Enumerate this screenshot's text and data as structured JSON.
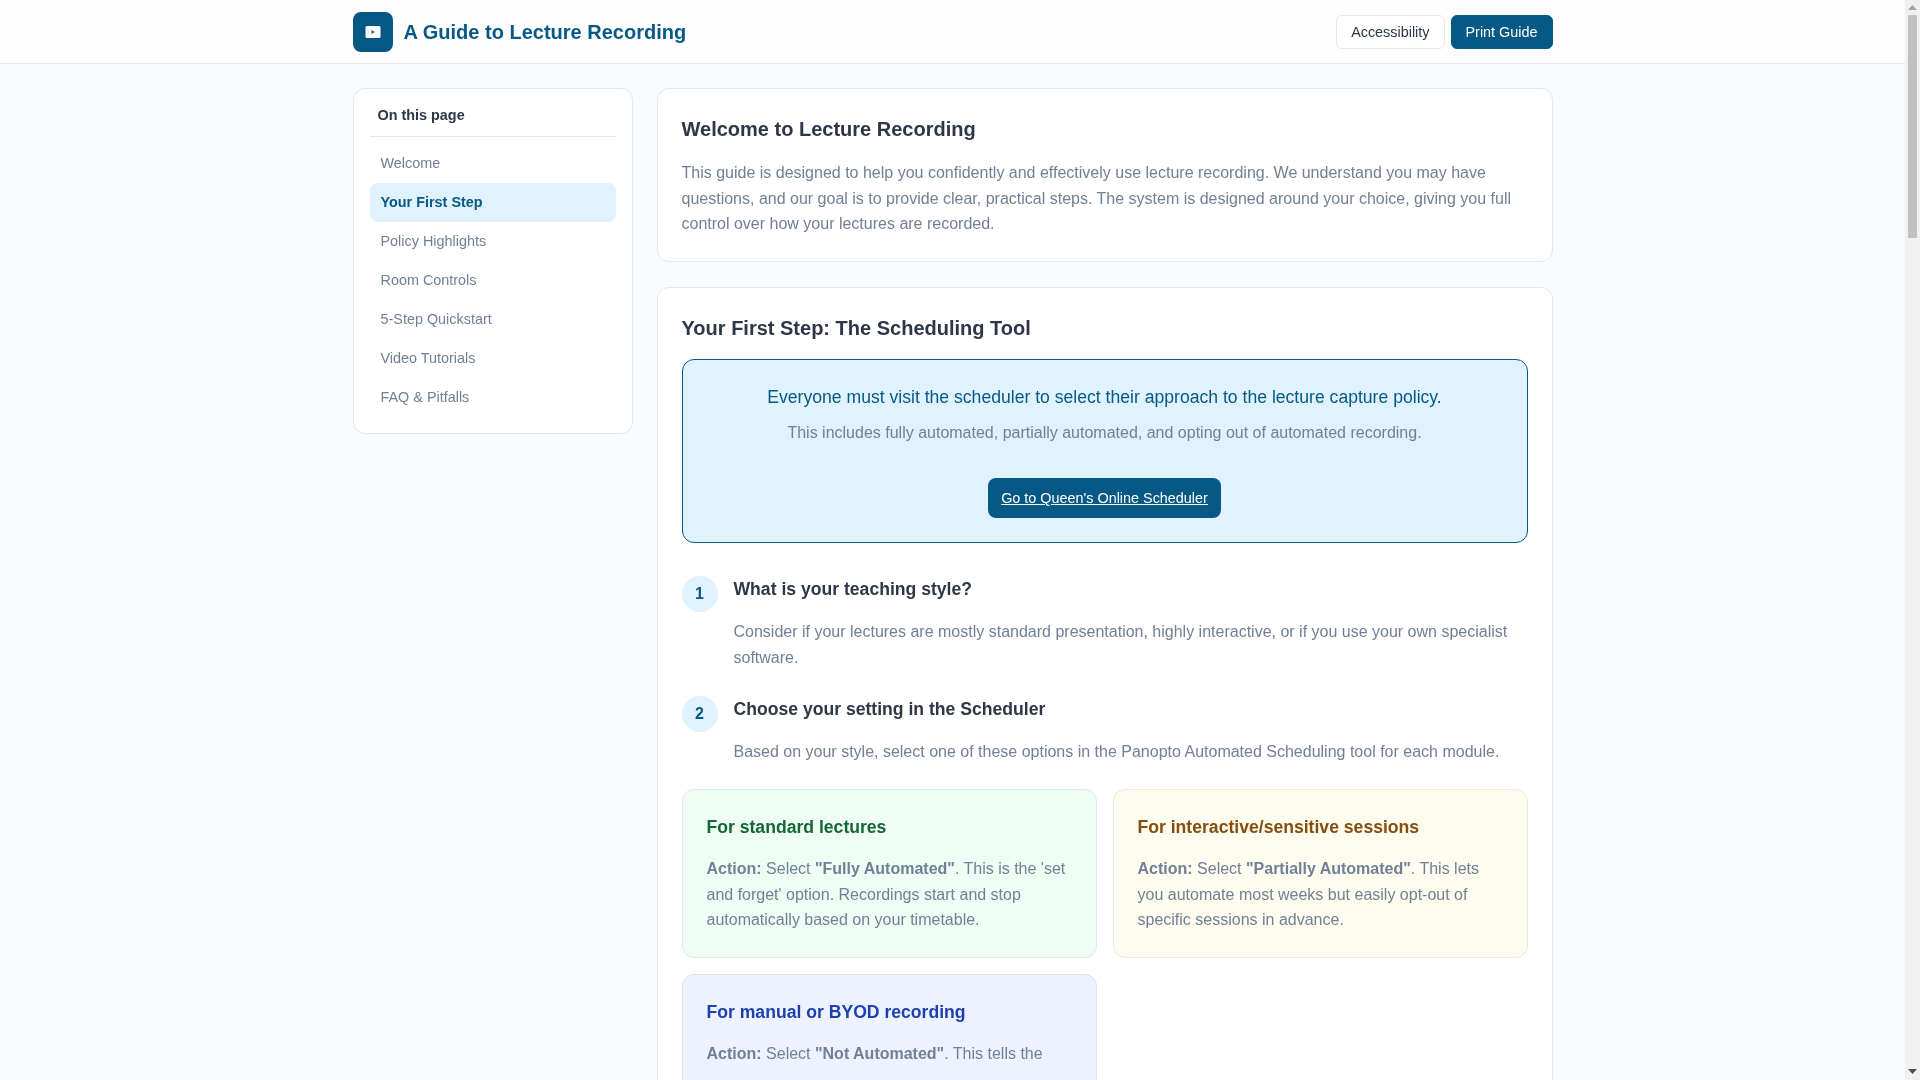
{
  "header": {
    "title": "A Guide to Lecture Recording",
    "buttons": [
      {
        "label": "Accessibility",
        "kind": "outline"
      },
      {
        "label": "Print Guide",
        "kind": "filled"
      }
    ]
  },
  "sidebar": {
    "title": "On this page",
    "items": [
      {
        "label": "Welcome",
        "selected": false
      },
      {
        "label": "Your First Step",
        "selected": true
      },
      {
        "label": "Policy Highlights",
        "selected": false
      },
      {
        "label": "Room Controls",
        "selected": false
      },
      {
        "label": "5-Step Quickstart",
        "selected": false
      },
      {
        "label": "Video Tutorials",
        "selected": false
      },
      {
        "label": "FAQ & Pitfalls",
        "selected": false
      }
    ]
  },
  "welcome": {
    "title": "Welcome to Lecture Recording",
    "text": "This guide is designed to help you confidently and effectively use lecture recording. We understand you may have questions, and our goal is to provide clear, practical steps. The system is designed around your choice, giving you full control over how your lectures are recorded."
  },
  "first_step": {
    "title": "Your First Step: The Scheduling Tool",
    "callout": {
      "heading": "Everyone must visit the scheduler to select their approach to the lecture capture policy.",
      "text": "This includes fully automated, partially automated, and opting out of automated recording.",
      "button": "Go to Queen's Online Scheduler"
    },
    "steps": [
      {
        "number": "1",
        "title": "What is your teaching style?",
        "text": "Consider if your lectures are mostly standard presentation, highly interactive, or if you use your own specialist software."
      },
      {
        "number": "2",
        "title": "Choose your setting in the Scheduler",
        "text": "Based on your style, select one of these options in the Panopto Automated Scheduling tool for each module."
      }
    ],
    "options": [
      {
        "title": "For standard lectures",
        "text": "**Action:** Select **\"Fully Automated\"**. This is the 'set and forget' option. Recordings start and stop automatically based on your timetable.",
        "color": "#166534"
      },
      {
        "title": "For interactive/sensitive sessions",
        "text": "**Action:** Select **\"Partially Automated\"**. This lets you automate most weeks but easily opt-out of specific sessions in advance.",
        "color": "#854d0e"
      },
      {
        "title": "For manual or BYOD recording",
        "text": "**Action:** Select **\"Not Automated\"**. This tells the",
        "color": "#1e40af"
      }
    ]
  }
}
